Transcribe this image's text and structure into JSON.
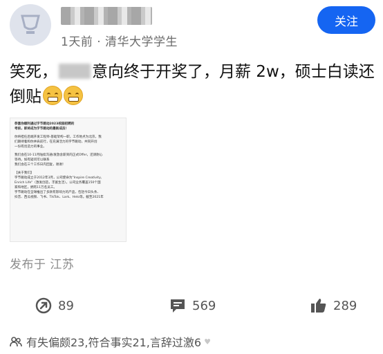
{
  "header": {
    "meta": "1天前 · 清华大学学生",
    "follow_label": "关注"
  },
  "post": {
    "text_before": "笑死，",
    "text_after": "意向终于开奖了，月薪 2w，硕士白读还倒贴"
  },
  "attachment": {
    "lines": [
      "恭喜你顺利通过字节跳动2023校园招聘的",
      "考核，即将成为字节跳动的最新成员！",
      "",
      "你将担任后端开发工程师-基础架构一职，工作地点为北京。我",
      "们期待着和你并肩前行，在充满活力的字节跳动，共同开创",
      "一份有创造力的事业。",
      "",
      "我们会在10-11月陆续沟通/发放含薪资的正式Offer，还请耐心",
      "等待。如有疑问可以联系",
      "我们会在三个工作日内回复，谢谢！",
      "",
      "【关于我们】",
      "字节跳动成立于2012年3月，公司使命为\"Inspire Creativity,",
      "Enrich Life\"（激发创造，丰富生活）。公司业务覆盖150个国",
      "家和地区，拥有11万名员工。",
      "字节跳动在全球推出了多款有影响力的产品，包括今日头条、",
      "抖音、西瓜视频、飞书、TikTok、Lark、Helo等。截至2021年"
    ]
  },
  "location": "发布于 江苏",
  "actions": {
    "share_count": "89",
    "comment_count": "569",
    "like_count": "289"
  },
  "footer": {
    "stats": "有失偏颇23,符合事实21,言辞过激6"
  },
  "colors": {
    "accent": "#1565f2",
    "muted": "#8c8c8c"
  }
}
